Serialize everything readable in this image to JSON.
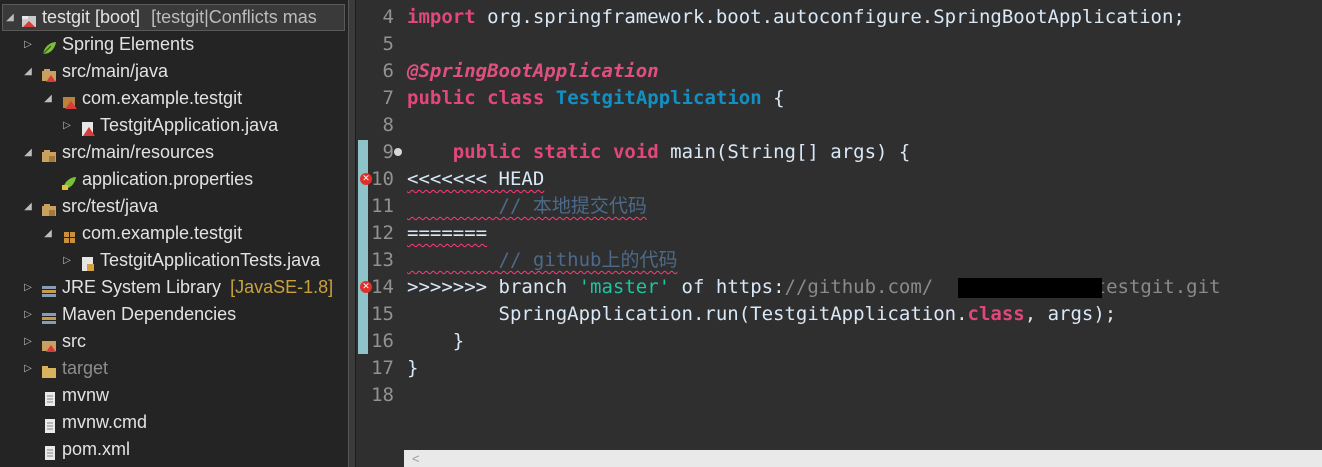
{
  "explorer": {
    "project_label": "testgit [boot]",
    "project_decor": "[testgit|Conflicts mas",
    "items": [
      {
        "label": "Spring Elements",
        "icon": "spring-leaf-icon"
      },
      {
        "label": "src/main/java",
        "icon": "source-folder-conflict-icon"
      },
      {
        "label": "com.example.testgit",
        "icon": "package-conflict-icon"
      },
      {
        "label": "TestgitApplication.java",
        "icon": "java-file-conflict-icon"
      },
      {
        "label": "src/main/resources",
        "icon": "source-folder-icon"
      },
      {
        "label": "application.properties",
        "icon": "properties-file-icon"
      },
      {
        "label": "src/test/java",
        "icon": "source-folder-icon"
      },
      {
        "label": "com.example.testgit",
        "icon": "package-icon"
      },
      {
        "label": "TestgitApplicationTests.java",
        "icon": "java-file-icon"
      },
      {
        "label": "JRE System Library",
        "decor": "[JavaSE-1.8]",
        "icon": "library-icon"
      },
      {
        "label": "Maven Dependencies",
        "icon": "library-icon"
      },
      {
        "label": "src",
        "icon": "folder-conflict-icon"
      },
      {
        "label": "target",
        "icon": "folder-icon"
      },
      {
        "label": "mvnw",
        "icon": "file-icon"
      },
      {
        "label": "mvnw.cmd",
        "icon": "file-icon"
      },
      {
        "label": "pom.xml",
        "icon": "file-icon"
      }
    ]
  },
  "editor": {
    "line_numbers": [
      "4",
      "5",
      "6",
      "7",
      "8",
      "9",
      "10",
      "11",
      "12",
      "13",
      "14",
      "15",
      "16",
      "17",
      "18"
    ],
    "lines": {
      "l4_kw": "import",
      "l4_rest": " org.springframework.boot.autoconfigure.SpringBootApplication;",
      "l6_ann": "@SpringBootApplication",
      "l7_kw1": "public",
      "l7_kw2": "class",
      "l7_cls": "TestgitApplication",
      "l7_rest": " {",
      "l9_indent": "    ",
      "l9_kw1": "public",
      "l9_kw2": "static",
      "l9_kw3": "void",
      "l9_rest": " main(String[] args) {",
      "l10": "<<<<<<< HEAD",
      "l11_indent": "        ",
      "l11_cmt": "// 本地提交代码",
      "l12": "=======",
      "l13_indent": "        ",
      "l13_cmt": "// github上的代码",
      "l14_a": ">>>>>>> branch ",
      "l14_str": "'master'",
      "l14_b": " of ",
      "l14_c": "https:",
      "l14_d": "//github.com/",
      "l14_e": "/testgit.git",
      "l15_a": "        SpringApplication.run(TestgitApplication.",
      "l15_kw": "class",
      "l15_b": ", args);",
      "l16": "    }",
      "l17": "}"
    },
    "colors": {
      "keyword": "#e2477a",
      "class_name": "#1290c3",
      "string": "#17c6a3",
      "comment": "#4d6a8a",
      "current_line": "#163f4a"
    }
  }
}
